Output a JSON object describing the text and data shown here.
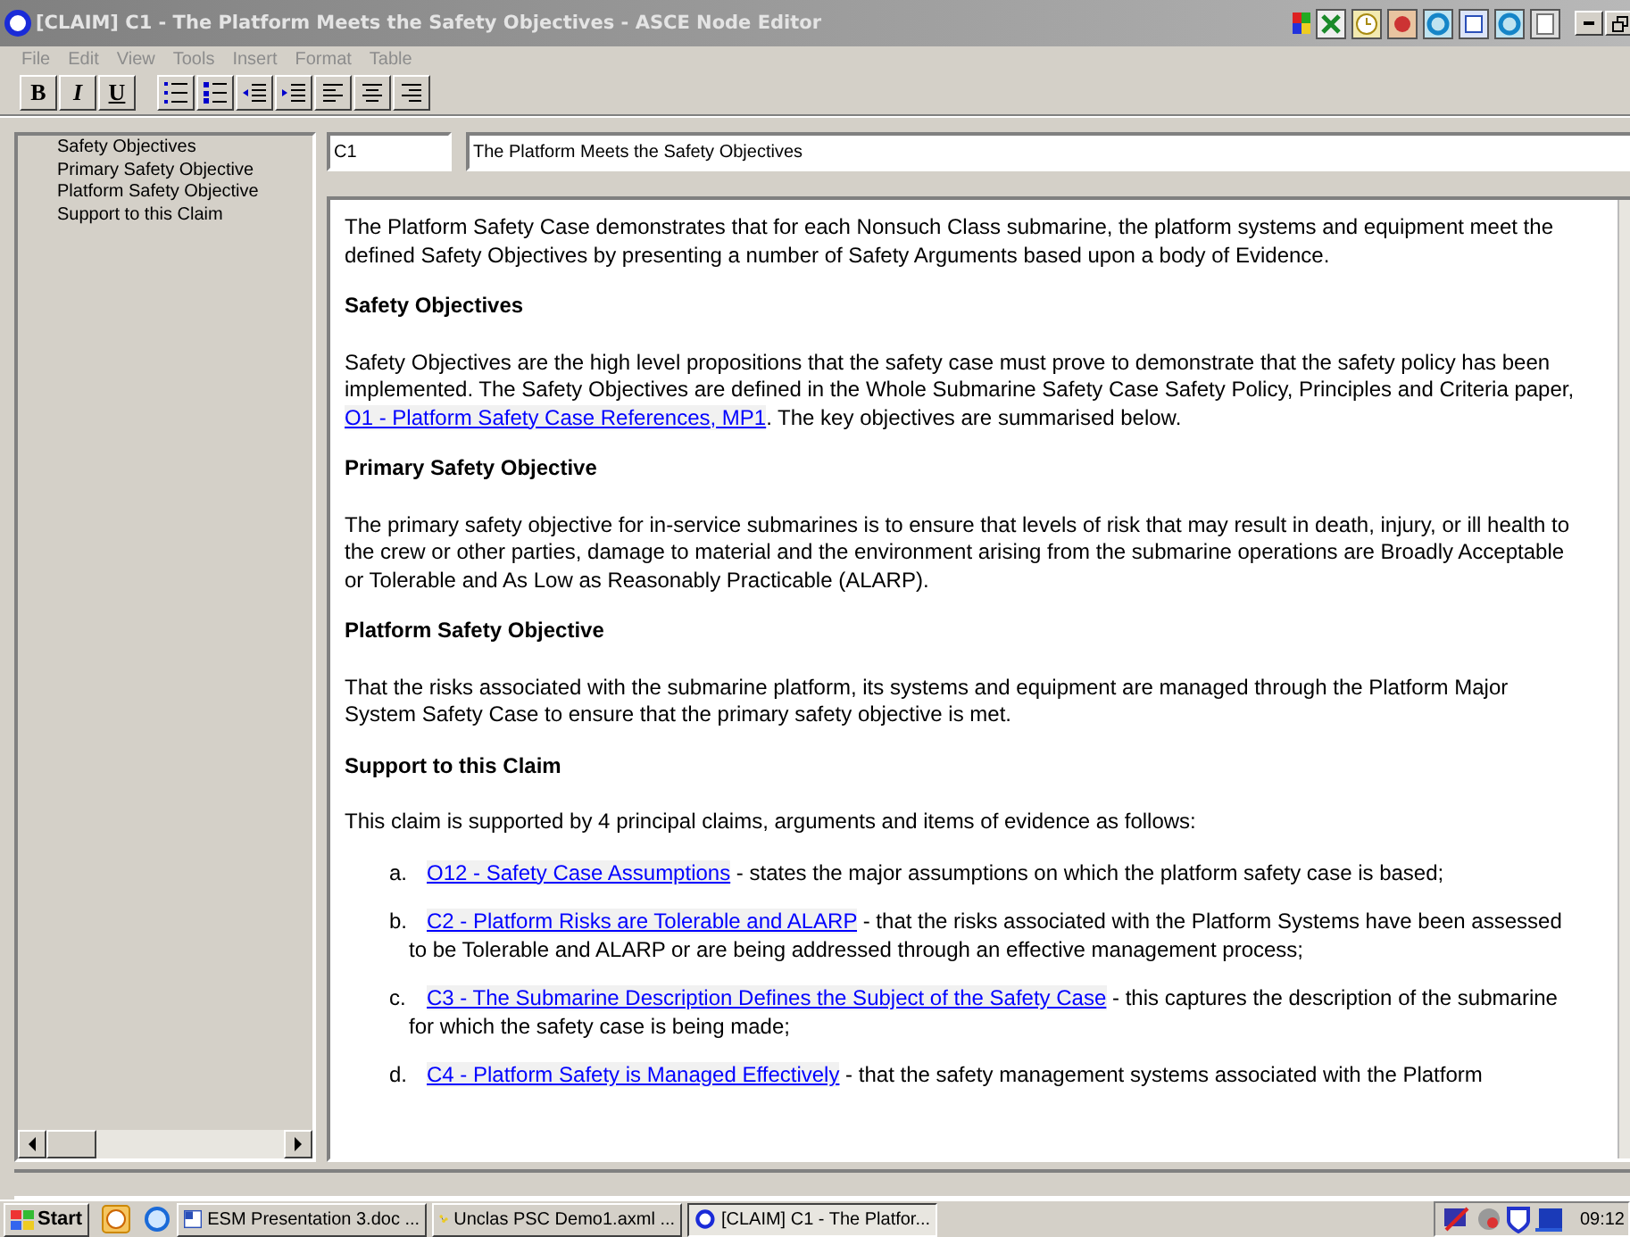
{
  "window": {
    "title": "[CLAIM] C1 - The Platform Meets the Safety Objectives - ASCE Node Editor"
  },
  "menu": [
    "File",
    "Edit",
    "View",
    "Tools",
    "Insert",
    "Format",
    "Table"
  ],
  "format_buttons": [
    "B",
    "I",
    "U"
  ],
  "outline": [
    {
      "label": "Safety Objectives"
    },
    {
      "label": "Primary Safety Objective"
    },
    {
      "label": "Platform Safety Objective"
    },
    {
      "label": "Support to this Claim"
    }
  ],
  "node": {
    "id": "C1",
    "title": "The Platform Meets the Safety Objectives"
  },
  "document": [
    {
      "kind": "para",
      "parts": [
        {
          "kind": "text",
          "text": "The Platform Safety Case demonstrates that for each Nonsuch Class submarine, the platform systems and equipment meet the defined Safety Objectives by presenting a number of Safety Arguments based upon a body of Evidence."
        }
      ]
    },
    {
      "kind": "heading",
      "text": "Safety Objectives"
    },
    {
      "kind": "para",
      "parts": [
        {
          "kind": "text",
          "text": "Safety Objectives are the high level propositions that the safety case must prove to demonstrate that the safety policy has been implemented.  The Safety Objectives are defined in the Whole Submarine Safety Case Safety Policy, Principles and Criteria paper, "
        },
        {
          "kind": "link",
          "text": "O1 - Platform Safety Case References, MP1"
        },
        {
          "kind": "text",
          "text": ".  The key objectives are summarised below."
        }
      ]
    },
    {
      "kind": "heading",
      "text": "Primary Safety Objective"
    },
    {
      "kind": "para",
      "parts": [
        {
          "kind": "text",
          "text": "The primary safety objective for in-service submarines is to ensure that levels of risk that may result in death, injury, or ill health to the crew or other parties, damage to material and the environment arising from the submarine operations are Broadly Acceptable or Tolerable and As Low as Reasonably Practicable (ALARP)."
        }
      ]
    },
    {
      "kind": "heading",
      "text": "Platform Safety Objective"
    },
    {
      "kind": "para",
      "parts": [
        {
          "kind": "text",
          "text": "That the risks associated with the submarine platform, its systems and equipment are managed through the Platform Major System Safety Case to ensure that the primary safety objective is met."
        }
      ]
    },
    {
      "kind": "heading",
      "text": "Support to this Claim"
    },
    {
      "kind": "para",
      "parts": [
        {
          "kind": "text",
          "text": "This claim is supported by 4 principal claims, arguments and items of evidence as follows:"
        }
      ]
    },
    {
      "kind": "item",
      "marker": "a.",
      "parts": [
        {
          "kind": "link",
          "text": "O12 - Safety Case Assumptions"
        },
        {
          "kind": "text",
          "text": " - states the major assumptions on which the platform safety case is based;"
        }
      ]
    },
    {
      "kind": "item",
      "marker": "b.",
      "parts": [
        {
          "kind": "link",
          "text": "C2 - Platform Risks are Tolerable and ALARP"
        },
        {
          "kind": "text",
          "text": " - that the risks associated with the Platform Systems have been assessed to be Tolerable and ALARP or are being addressed through an effective management process;"
        }
      ]
    },
    {
      "kind": "item",
      "marker": "c.",
      "parts": [
        {
          "kind": "link",
          "text": "C3 - The Submarine Description Defines the Subject of the Safety Case"
        },
        {
          "kind": "text",
          "text": " - this captures the description of the submarine for which the safety case is being made;"
        }
      ]
    },
    {
      "kind": "item",
      "marker": "d.",
      "parts": [
        {
          "kind": "link",
          "text": "C4 - Platform Safety is Managed Effectively"
        },
        {
          "kind": "text",
          "text": " - that the safety management systems associated with the Platform"
        }
      ]
    }
  ],
  "taskbar": {
    "start": "Start",
    "tasks": [
      {
        "label": "ESM Presentation 3.doc ...",
        "selected": false
      },
      {
        "label": "Unclas PSC Demo1.axml ...",
        "selected": false
      },
      {
        "label": "[CLAIM] C1 - The Platfor...",
        "selected": true
      }
    ],
    "clock": "09:12"
  }
}
